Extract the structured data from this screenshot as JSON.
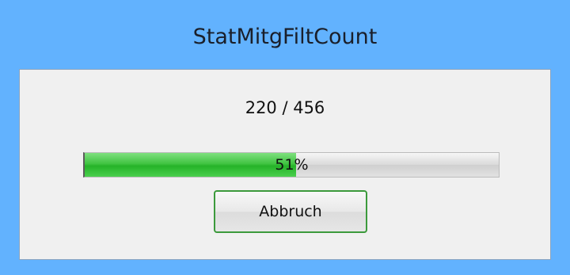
{
  "window": {
    "title": "StatMitgFiltCount"
  },
  "progress": {
    "count_text": "220 / 456",
    "fraction": 0.51,
    "percent_label": "51%"
  },
  "buttons": {
    "cancel_label": "Abbruch"
  }
}
